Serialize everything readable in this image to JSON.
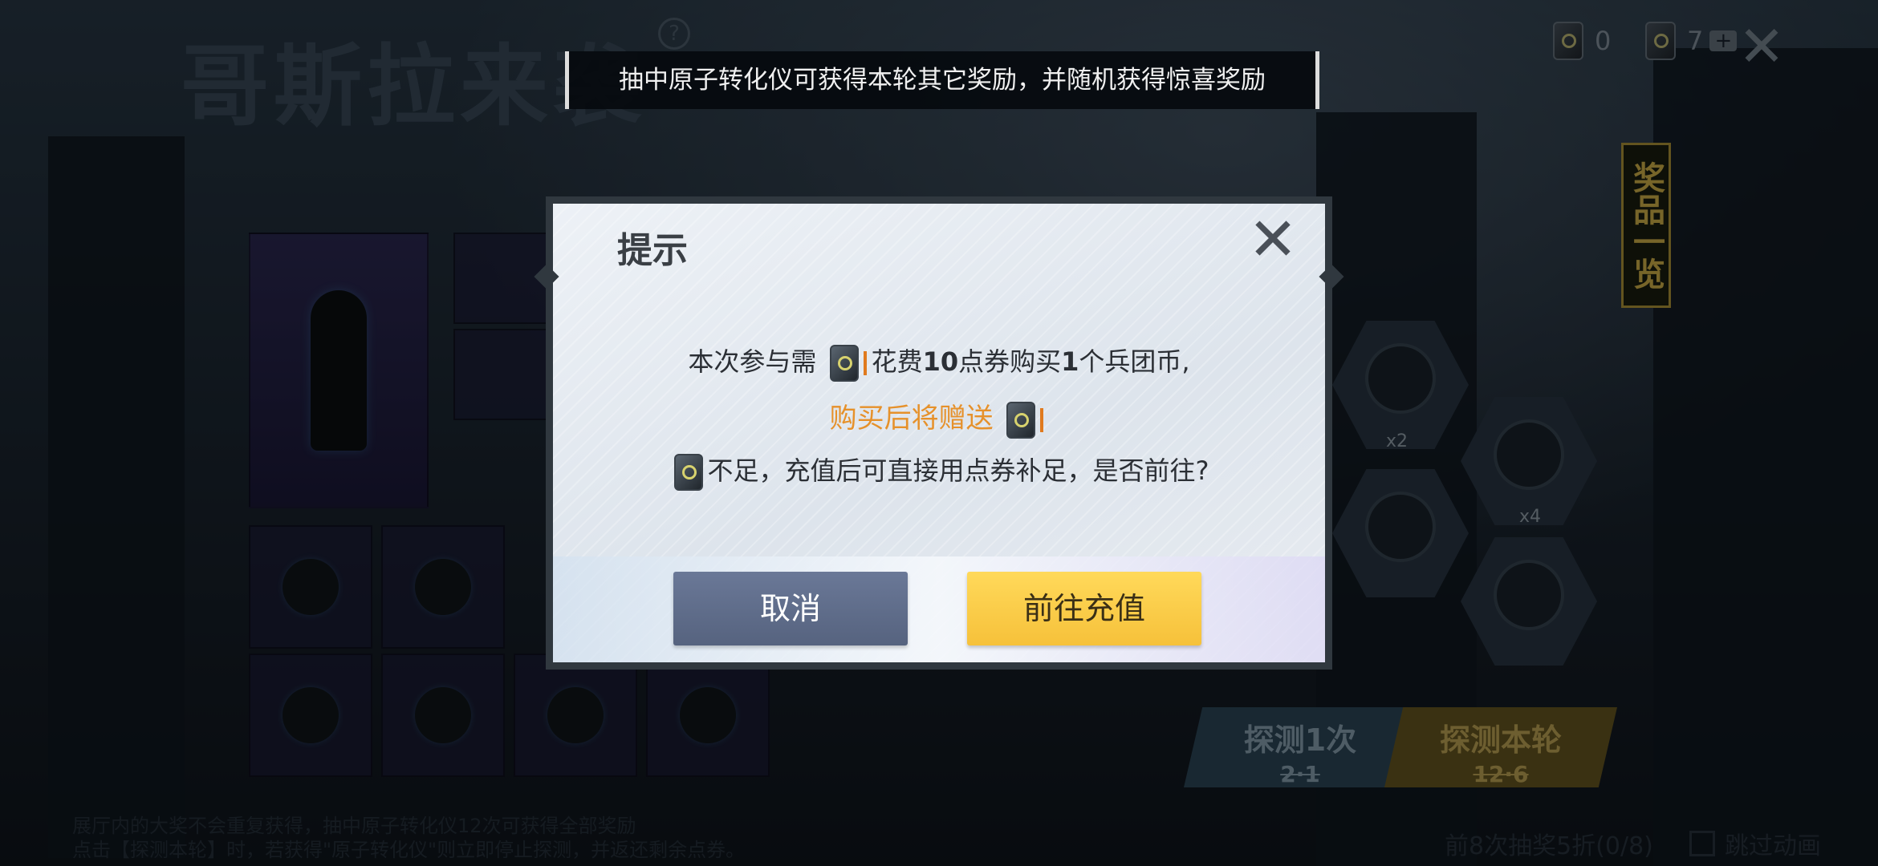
{
  "event": {
    "title": "哥斯拉来袭",
    "help_mark": "?"
  },
  "banner": {
    "text": "抽中原子转化仪可获得本轮其它奖励，并随机获得惊喜奖励"
  },
  "header": {
    "currency1_count": "0",
    "currency2_count": "7",
    "plus_label": "+",
    "close_label": "✕"
  },
  "sidebar": {
    "prize_list_label": "奖品一览"
  },
  "hex_items": [
    {
      "label": "x2"
    },
    {
      "label": "x4"
    }
  ],
  "actions": {
    "draw_once_label": "探测1次",
    "draw_once_price": "2·1",
    "draw_round_label": "探测本轮",
    "draw_round_price": "12·6"
  },
  "footer": {
    "note_line1": "展厅内的大奖不会重复获得，抽中原子转化仪12次可获得全部奖励",
    "note_line2": "点击【探测本轮】时，若获得\"原子转化仪\"则立即停止探测，并返还剩余点券。",
    "discount_text": "前8次抽奖5折(0/8)",
    "skip_label": "跳过动画"
  },
  "dialog": {
    "title": "提示",
    "close_label": "✕",
    "line1_pre": "本次参与需",
    "line1_mid": "花费",
    "line1_amount": "10",
    "line1_unit": "点券购买",
    "line1_count": "1",
    "line1_post": "个兵团币,",
    "line2": "购买后将赠送",
    "line3": "不足，充值后可直接用点券补足，是否前往?",
    "cancel_label": "取消",
    "confirm_label": "前往充值"
  },
  "colors": {
    "orange_text": "#e6912b",
    "confirm_button": "#f6c13a",
    "cancel_button": "#5f6c89"
  }
}
